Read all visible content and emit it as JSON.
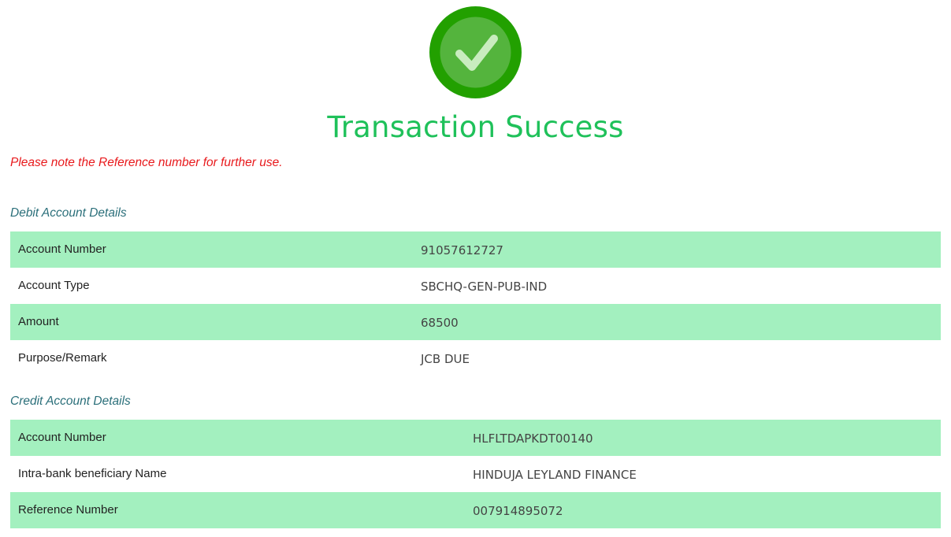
{
  "header": {
    "title": "Transaction Success",
    "note": "Please note the Reference number for further use."
  },
  "colors": {
    "success_green": "#1fc15a",
    "icon_outer": "#22a000",
    "icon_inner": "#54b43d",
    "note_red": "#e8191c",
    "heading_teal": "#2b6f7a",
    "row_highlight": "#a3f0bf"
  },
  "icons": {
    "status": "check-circle-icon"
  },
  "debit": {
    "heading": "Debit Account Details",
    "rows": [
      {
        "label": "Account Number",
        "value": "91057612727"
      },
      {
        "label": "Account Type",
        "value": "SBCHQ-GEN-PUB-IND"
      },
      {
        "label": "Amount",
        "value": "68500"
      },
      {
        "label": "Purpose/Remark",
        "value": "JCB DUE"
      }
    ]
  },
  "credit": {
    "heading": "Credit Account Details",
    "rows": [
      {
        "label": "Account Number",
        "value": "HLFLTDAPKDT00140"
      },
      {
        "label": "Intra-bank beneficiary Name",
        "value": "HINDUJA LEYLAND FINANCE"
      },
      {
        "label": "Reference Number",
        "value": "007914895072"
      }
    ]
  }
}
